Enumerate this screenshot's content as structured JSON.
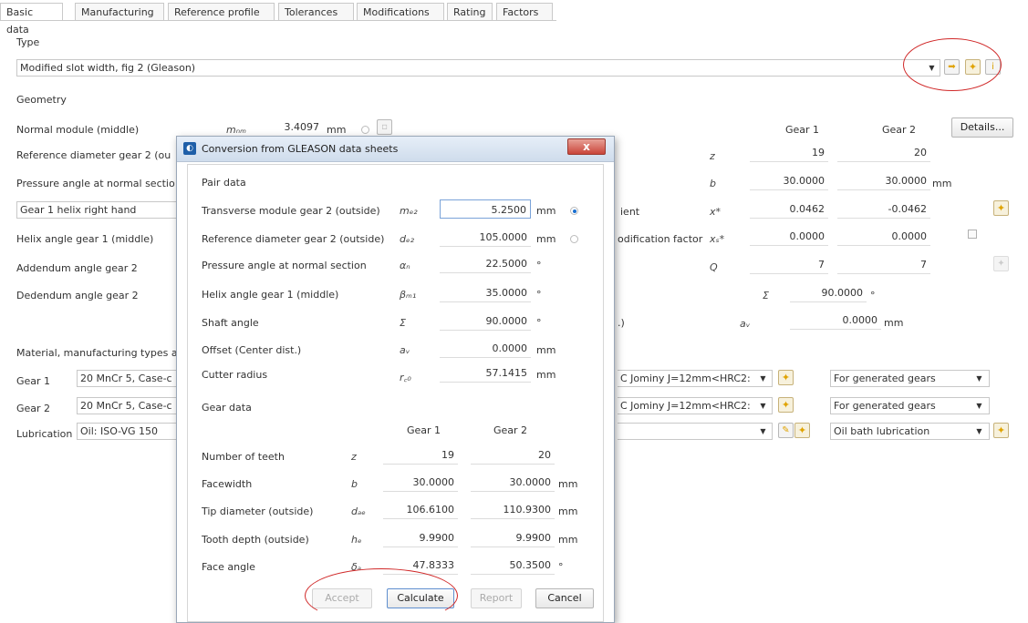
{
  "tabs": [
    "Basic data",
    "Manufacturing",
    "Reference profile",
    "Tolerances",
    "Modifications",
    "Rating",
    "Factors"
  ],
  "type_section": {
    "label": "Type",
    "value": "Modified slot width, fig 2 (Gleason)"
  },
  "geometry": {
    "label": "Geometry",
    "normal_module": {
      "label": "Normal module (middle)",
      "symbol": "mₙₘ",
      "value": "3.4097",
      "unit": "mm"
    },
    "ref_diam_label": "Reference diameter gear 2 (ou",
    "pressure_label": "Pressure angle at normal sectio",
    "helix_dropdown": "Gear 1 helix right hand",
    "helix_angle_label": "Helix angle gear 1 (middle)",
    "addendum_label": "Addendum angle gear 2",
    "dedendum_label": "Dedendum angle gear 2",
    "gear1_header": "Gear 1",
    "gear2_header": "Gear 2",
    "details_button": "Details...",
    "rows": [
      {
        "label": "",
        "symbol": "z",
        "g1": "19",
        "g2": "20",
        "unit": ""
      },
      {
        "label": "",
        "symbol": "b",
        "g1": "30.0000",
        "g2": "30.0000",
        "unit": "mm"
      },
      {
        "label": "ient",
        "symbol": "x*",
        "g1": "0.0462",
        "g2": "-0.0462",
        "unit": ""
      },
      {
        "label": "odification factor",
        "symbol": "xₛ*",
        "g1": "0.0000",
        "g2": "0.0000",
        "unit": ""
      },
      {
        "label": "",
        "symbol": "Q",
        "g1": "7",
        "g2": "7",
        "unit": ""
      }
    ],
    "sigma": {
      "symbol": "Σ",
      "value": "90.0000",
      "unit": "°"
    },
    "offset": {
      "prefix": ".)",
      "symbol": "aᵥ",
      "value": "0.0000",
      "unit": "mm"
    }
  },
  "material": {
    "label": "Material, manufacturing types a",
    "gear1": {
      "label": "Gear 1",
      "material": "20 MnCr 5, Case-c",
      "heat": "C Jominy J=12mm<HRC2:",
      "type": "For generated gears"
    },
    "gear2": {
      "label": "Gear 2",
      "material": "20 MnCr 5, Case-c",
      "heat": "C Jominy J=12mm<HRC2:",
      "type": "For generated gears"
    },
    "lubrication": {
      "label": "Lubrication",
      "oil": "Oil: ISO-VG 150",
      "method": "Oil bath lubrication"
    }
  },
  "dialog": {
    "title": "Conversion from GLEASON data sheets",
    "close": "x",
    "pair_data_label": "Pair data",
    "pair_rows": [
      {
        "label": "Transverse module gear 2 (outside)",
        "symbol": "mₑ₂",
        "value": "5.2500",
        "unit": "mm"
      },
      {
        "label": "Reference diameter gear 2 (outside)",
        "symbol": "dₑ₂",
        "value": "105.0000",
        "unit": "mm"
      },
      {
        "label": "Pressure angle at normal section",
        "symbol": "αₙ",
        "value": "22.5000",
        "unit": "°"
      },
      {
        "label": "Helix angle gear 1 (middle)",
        "symbol": "βₘ₁",
        "value": "35.0000",
        "unit": "°"
      },
      {
        "label": "Shaft angle",
        "symbol": "Σ",
        "value": "90.0000",
        "unit": "°"
      },
      {
        "label": "Offset (Center dist.)",
        "symbol": "aᵥ",
        "value": "0.0000",
        "unit": "mm"
      },
      {
        "label": "Cutter radius",
        "symbol": "r꜀₀",
        "value": "57.1415",
        "unit": "mm"
      }
    ],
    "gear_data_label": "Gear data",
    "gear1_header": "Gear 1",
    "gear2_header": "Gear 2",
    "gear_rows": [
      {
        "label": "Number of teeth",
        "symbol": "z",
        "g1": "19",
        "g2": "20",
        "unit": ""
      },
      {
        "label": "Facewidth",
        "symbol": "b",
        "g1": "30.0000",
        "g2": "30.0000",
        "unit": "mm"
      },
      {
        "label": "Tip diameter (outside)",
        "symbol": "dₐₑ",
        "g1": "106.6100",
        "g2": "110.9300",
        "unit": "mm"
      },
      {
        "label": "Tooth depth (outside)",
        "symbol": "hₑ",
        "g1": "9.9900",
        "g2": "9.9900",
        "unit": "mm"
      },
      {
        "label": "Face angle",
        "symbol": "δₐ",
        "g1": "47.8333",
        "g2": "50.3500",
        "unit": "°"
      }
    ],
    "buttons": {
      "accept": "Accept",
      "calculate": "Calculate",
      "report": "Report",
      "cancel": "Cancel"
    }
  },
  "colors": {
    "annotation": "#d02828",
    "radio_selected": "#1a6fd0",
    "close_button": "#c9453a",
    "star_icon": "#e0a300"
  }
}
